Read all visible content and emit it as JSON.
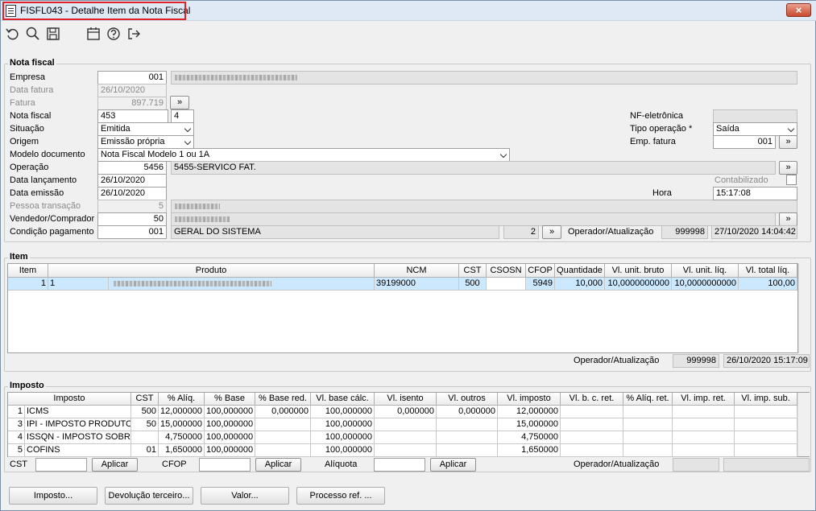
{
  "window": {
    "title": "FISFL043 - Detalhe Item da Nota Fiscal",
    "close_label": "×"
  },
  "nota": {
    "group_title": "Nota fiscal",
    "empresa_label": "Empresa",
    "empresa_value": "001",
    "data_fatura_label": "Data fatura",
    "data_fatura_value": "26/10/2020",
    "fatura_label": "Fatura",
    "fatura_value": "897.719",
    "nota_label": "Nota fiscal",
    "nota_value": "453",
    "serie_value": "4",
    "situacao_label": "Situação",
    "situacao_value": "Emitida",
    "origem_label": "Origem",
    "origem_value": "Emissão própria",
    "modelo_label": "Modelo documento",
    "modelo_value": "Nota Fiscal Modelo 1 ou 1A",
    "operacao_label": "Operação",
    "operacao_code": "5456",
    "operacao_desc": "5455-SERVICO FAT.",
    "data_lanc_label": "Data lançamento",
    "data_lanc_value": "26/10/2020",
    "data_emis_label": "Data emissão",
    "data_emis_value": "26/10/2020",
    "pessoa_label": "Pessoa transação",
    "pessoa_value": "5",
    "vendedor_label": "Vendedor/Comprador",
    "vendedor_value": "50",
    "condicao_label": "Condição pagamento",
    "condicao_value": "001",
    "condicao_desc": "GERAL DO SISTEMA",
    "condicao_num": "2",
    "nfe_label": "NF-eletrônica",
    "tipo_op_label": "Tipo operação *",
    "tipo_op_value": "Saída",
    "emp_fatura_label": "Emp. fatura",
    "emp_fatura_value": "001",
    "contab_label": "Contabilizado",
    "hora_label": "Hora",
    "hora_value": "15:17:08",
    "op_atual_label": "Operador/Atualização",
    "op_code": "999998",
    "op_date": "27/10/2020 14:04:42",
    "more_label": "»"
  },
  "item": {
    "group_title": "Item",
    "headers": [
      "Item",
      "Produto",
      "NCM",
      "CST",
      "CSOSN",
      "CFOP",
      "Quantidade",
      "Vl. unit. bruto",
      "Vl. unit. líq.",
      "Vl. total líq."
    ],
    "row": {
      "item": "1",
      "code": "1",
      "ncm": "39199000",
      "cst": "500",
      "csosn": "",
      "cfop": "5949",
      "qtd": "10,000",
      "vub": "10,0000000000",
      "vul": "10,0000000000",
      "vtl": "100,00"
    },
    "op_atual_label": "Operador/Atualização",
    "op_code": "999998",
    "op_date": "26/10/2020 15:17:09"
  },
  "imposto": {
    "group_title": "Imposto",
    "headers": [
      "Imposto",
      "CST",
      "% Alíq.",
      "% Base",
      "% Base red.",
      "Vl. base cálc.",
      "Vl. isento",
      "Vl. outros",
      "Vl. imposto",
      "Vl. b. c. ret.",
      "% Alíq. ret.",
      "Vl. imp. ret.",
      "Vl. imp. sub."
    ],
    "rows": [
      {
        "n": "1",
        "nome": "ICMS",
        "cst": "500",
        "aliq": "12,000000",
        "base": "100,000000",
        "bred": "0,000000",
        "vbase": "100,000000",
        "isento": "0,000000",
        "outros": "0,000000",
        "vimp": "12,000000"
      },
      {
        "n": "3",
        "nome": "IPI - IMPOSTO PRODUTO IN",
        "cst": "50",
        "aliq": "15,000000",
        "base": "100,000000",
        "bred": "",
        "vbase": "100,000000",
        "isento": "",
        "outros": "",
        "vimp": "15,000000"
      },
      {
        "n": "4",
        "nome": "ISSQN - IMPOSTO SOBRE S",
        "cst": "",
        "aliq": "4,750000",
        "base": "100,000000",
        "bred": "",
        "vbase": "100,000000",
        "isento": "",
        "outros": "",
        "vimp": "4,750000"
      },
      {
        "n": "5",
        "nome": "COFINS",
        "cst": "01",
        "aliq": "1,650000",
        "base": "100,000000",
        "bred": "",
        "vbase": "100,000000",
        "isento": "",
        "outros": "",
        "vimp": "1,650000"
      }
    ],
    "cst_label": "CST",
    "cfop_label": "CFOP",
    "aliquota_label": "Alíquota",
    "aplicar_label": "Aplicar",
    "op_atual_label": "Operador/Atualização"
  },
  "footer": {
    "imposto": "Imposto...",
    "devolucao": "Devolução terceiro...",
    "valor": "Valor...",
    "processo": "Processo ref. ..."
  }
}
